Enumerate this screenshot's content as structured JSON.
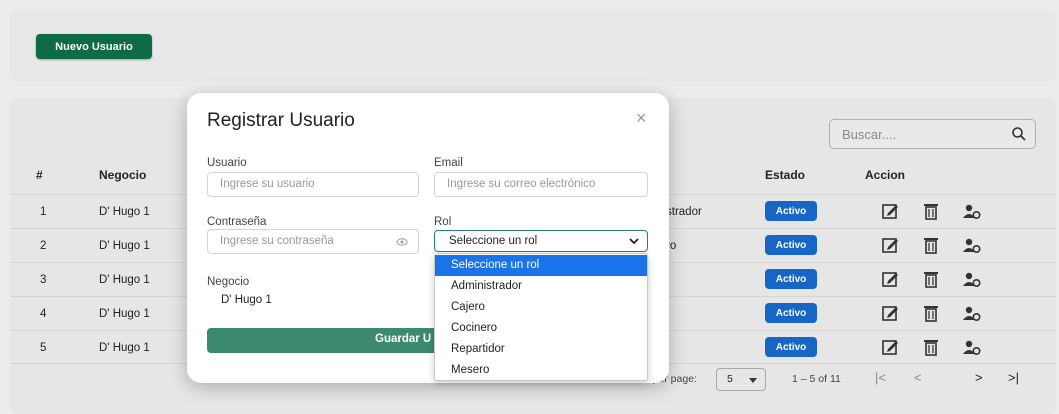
{
  "header": {
    "new_user_button": "Nuevo Usuario"
  },
  "search": {
    "placeholder": "Buscar...."
  },
  "table": {
    "columns": [
      "#",
      "Negocio",
      "Estado",
      "Accion"
    ],
    "rows": [
      {
        "num": "1",
        "negocio": "D' Hugo 1",
        "rol_fragment": "strador",
        "estado": "Activo"
      },
      {
        "num": "2",
        "negocio": "D' Hugo 1",
        "rol_fragment": "ro",
        "estado": "Activo"
      },
      {
        "num": "3",
        "negocio": "D' Hugo 1",
        "rol_fragment": "",
        "estado": "Activo"
      },
      {
        "num": "4",
        "negocio": "D' Hugo 1",
        "rol_fragment": "",
        "estado": "Activo"
      },
      {
        "num": "5",
        "negocio": "D' Hugo 1",
        "rol_fragment": "",
        "estado": "Activo"
      }
    ]
  },
  "pagination": {
    "items_per_page_label": "Items per page:",
    "items_per_page_value": "5",
    "range": "1 – 5 of 11",
    "first": "|<",
    "prev": "<",
    "next": ">",
    "last": ">|"
  },
  "modal": {
    "title": "Registrar Usuario",
    "close": "×",
    "usuario_label": "Usuario",
    "usuario_placeholder": "Ingrese su usuario",
    "email_label": "Email",
    "email_placeholder": "Ingrese su correo electrónico",
    "password_label": "Contraseña",
    "password_placeholder": "Ingrese su contraseña",
    "rol_label": "Rol",
    "rol_selected": "Seleccione un rol",
    "negocio_label": "Negocio",
    "negocio_value": "D' Hugo 1",
    "save_label": "Guardar U",
    "rol_options": [
      "Seleccione un rol",
      "Administrador",
      "Cajero",
      "Cocinero",
      "Repartidor",
      "Mesero"
    ]
  },
  "colors": {
    "primary_green": "#0d6b45",
    "badge_blue": "#1665c7",
    "select_highlight": "#1a73e8"
  },
  "icons": [
    "search-icon",
    "edit-icon",
    "trash-icon",
    "user-role-icon",
    "eye-icon",
    "chevron-down-icon",
    "close-icon"
  ]
}
